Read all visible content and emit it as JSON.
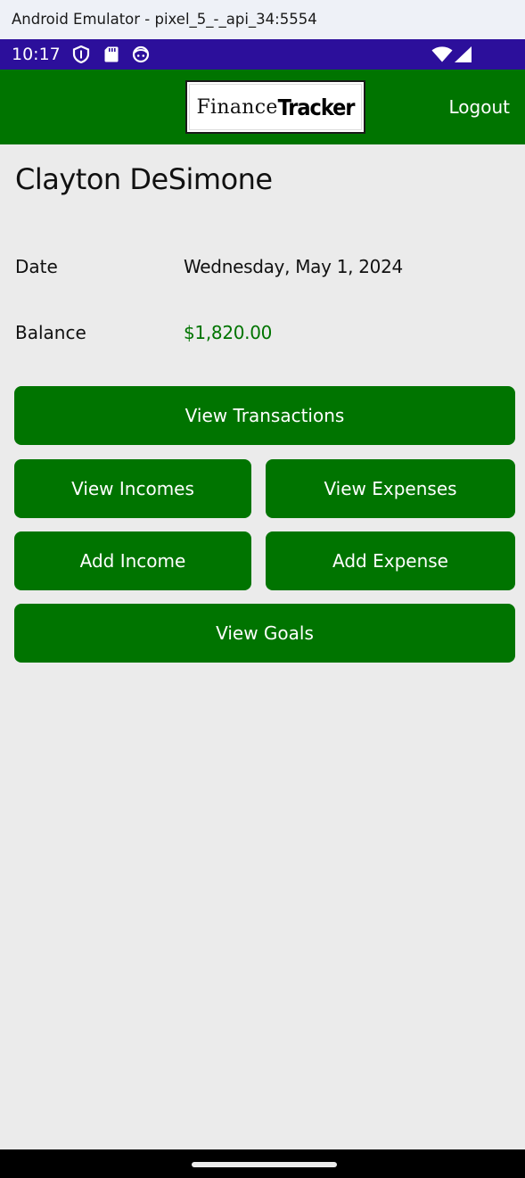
{
  "window": {
    "title": "Android Emulator - pixel_5_-_api_34:5554"
  },
  "status_bar": {
    "time": "10:17",
    "icons_left": [
      "shield-icon",
      "sd-card-icon",
      "face-icon"
    ],
    "icons_right": [
      "wifi-icon",
      "cellular-signal-icon"
    ],
    "background_color": "#2c0f9b"
  },
  "header": {
    "logo": {
      "part1": "Finance",
      "part2": "Tracker"
    },
    "logout_label": "Logout",
    "background_color": "#007400"
  },
  "profile": {
    "name": "Clayton DeSimone",
    "date_label": "Date",
    "date_value": "Wednesday, May 1, 2024",
    "balance_label": "Balance",
    "balance_value": "$1,820.00",
    "balance_color": "#007400"
  },
  "buttons": {
    "view_transactions": "View Transactions",
    "view_incomes": "View Incomes",
    "view_expenses": "View Expenses",
    "add_income": "Add Income",
    "add_expense": "Add Expense",
    "view_goals": "View Goals",
    "color": "#007400"
  }
}
